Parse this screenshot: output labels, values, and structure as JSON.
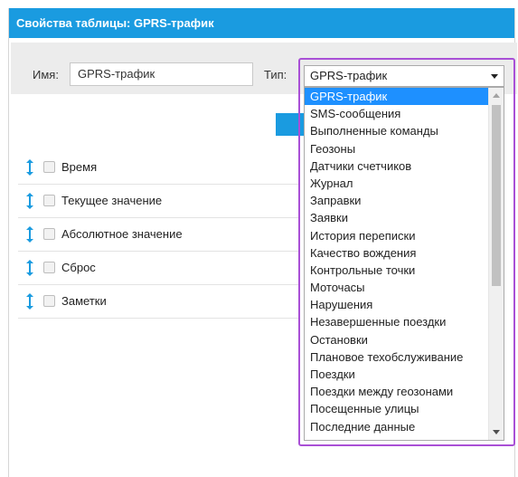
{
  "dialog": {
    "title": "Свойства таблицы: GPRS-трафик"
  },
  "form": {
    "name_label": "Имя:",
    "name_value": "GPRS-трафик",
    "type_label": "Тип:",
    "type_selected": "GPRS-трафик"
  },
  "columns": [
    {
      "label": "Время"
    },
    {
      "label": "Текущее значение"
    },
    {
      "label": "Абсолютное значение"
    },
    {
      "label": "Сброс"
    },
    {
      "label": "Заметки"
    }
  ],
  "type_options": [
    "GPRS-трафик",
    "SMS-сообщения",
    "Выполненные команды",
    "Геозоны",
    "Датчики счетчиков",
    "Журнал",
    "Заправки",
    "Заявки",
    "История переписки",
    "Качество вождения",
    "Контрольные точки",
    "Моточасы",
    "Нарушения",
    "Незавершенные поездки",
    "Остановки",
    "Плановое техобслуживание",
    "Поездки",
    "Поездки между геозонами",
    "Посещенные улицы",
    "Последние данные"
  ],
  "colors": {
    "accent": "#1a9be0",
    "selected_option": "#1e90ff",
    "highlight_frame": "#a94fd6"
  },
  "icons": {
    "drag": "drag-handle-icon",
    "checkbox": "checkbox-icon",
    "dropdown": "chevron-down-icon"
  }
}
